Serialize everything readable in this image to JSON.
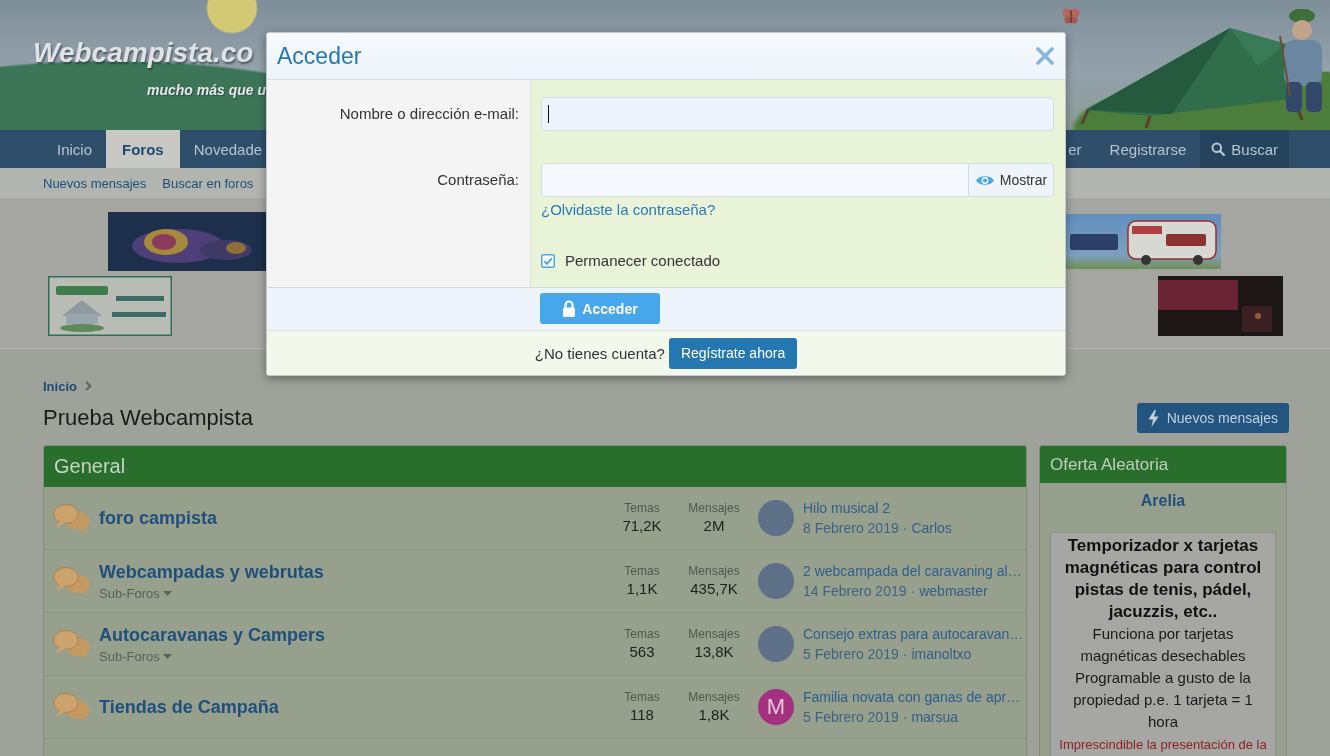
{
  "header": {
    "logo": "Webcampista.co",
    "tagline": "mucho más que u"
  },
  "nav": {
    "left_items": [
      {
        "label": "Inicio",
        "selected": false
      },
      {
        "label": "Foros",
        "selected": true
      },
      {
        "label": "Novedade",
        "selected": false
      }
    ],
    "right_items": [
      {
        "label": "er",
        "kind": "link",
        "selected": false
      },
      {
        "label": "Registrarse",
        "kind": "link",
        "selected": false
      },
      {
        "label": "Buscar",
        "kind": "search",
        "selected": false
      }
    ]
  },
  "subnav": {
    "links": [
      "Nuevos mensajes",
      "Buscar en foros"
    ]
  },
  "ad_rows": [
    [
      {
        "kind": "car"
      },
      {
        "kind": "camper"
      }
    ],
    [
      {
        "kind": "rental"
      },
      {
        "kind": "photo"
      }
    ]
  ],
  "breadcrumb": [
    "Inicio"
  ],
  "page_title": "Prueba Webcampista",
  "new_posts_button": "Nuevos mensajes",
  "forum_section": {
    "title": "General",
    "forums": [
      {
        "title": "foro campista",
        "threads_label": "Temas",
        "threads": "71,2K",
        "messages_label": "Mensajes",
        "messages": "2M",
        "last_post": {
          "avatar": {
            "kind": "photo"
          },
          "title": "Hilo musical 2",
          "date": "8 Febrero 2019",
          "separator": "·",
          "author": "Carlos"
        }
      },
      {
        "title": "Webcampadas y webrutas",
        "subforums": "Sub-Foros",
        "threads_label": "Temas",
        "threads": "1,1K",
        "messages_label": "Mensajes",
        "messages": "435,7K",
        "last_post": {
          "avatar": {
            "kind": "photo"
          },
          "title": "2 webcampada del caravaning al…",
          "date": "14 Febrero 2019",
          "separator": "·",
          "author": "webmaster"
        }
      },
      {
        "title": "Autocaravanas y Campers",
        "subforums": "Sub-Foros",
        "threads_label": "Temas",
        "threads": "563",
        "messages_label": "Mensajes",
        "messages": "13,8K",
        "last_post": {
          "avatar": {
            "kind": "photo"
          },
          "title": "Consejo extras para autocaravan…",
          "date": "5 Febrero 2019",
          "separator": "·",
          "author": "imanoltxo"
        }
      },
      {
        "title": "Tiendas de Campaña",
        "threads_label": "Temas",
        "threads": "118",
        "messages_label": "Mensajes",
        "messages": "1,8K",
        "last_post": {
          "avatar": {
            "kind": "letter",
            "letter": "M",
            "color": "#a3317f"
          },
          "title": "Familia novata con ganas de apr…",
          "date": "5 Febrero 2019",
          "separator": "·",
          "author": "marsua"
        }
      }
    ]
  },
  "sidebar": {
    "title": "Oferta Aleatoria",
    "product_link": "Arelia",
    "offer": {
      "headline": "Temporizador x tarjetas magnéticas para control pistas de tenis, pádel, jacuzzis, etc..",
      "paragraphs": [
        "Funciona por tarjetas magnéticas desechables",
        "Programable a gusto de la propiedad p.e. 1 tarjeta = 1 hora"
      ],
      "notice": "Imprescindible la presentación de la"
    }
  },
  "login_dialog": {
    "title": "Acceder",
    "fields": [
      {
        "label": "Nombre o dirección e-mail:",
        "kind": "text",
        "focused": true
      },
      {
        "label": "Contraseña:",
        "kind": "password",
        "focused": false,
        "toggle_label": "Mostrar",
        "link": "¿Olvidaste la contraseña?"
      }
    ],
    "remember_me": {
      "label": "Permanecer conectado",
      "checked": true
    },
    "submit": "Acceder",
    "signup_prompt": "¿No tienes cuenta?",
    "signup_button": "Regístrate ahora"
  }
}
